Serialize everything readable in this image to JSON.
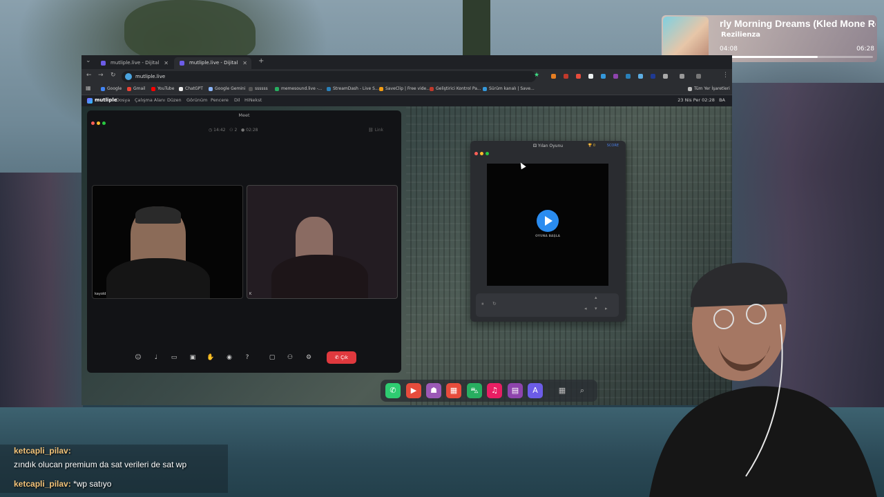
{
  "music": {
    "title": "rly Morning Dreams (Kled Mone Re",
    "artist": "Rezilienza",
    "elapsed": "04:08",
    "duration": "06:28",
    "progress": 0.64
  },
  "browser": {
    "tabs": [
      {
        "label": "mutliple.live - Dijital Çalışma Al",
        "active": false
      },
      {
        "label": "mutliple.live - Dijital Çalışm",
        "active": true
      }
    ],
    "new_tab": "+",
    "url": "mutliple.live",
    "bookmarks": [
      "Google",
      "Gmail",
      "YouTube",
      "ChatGPT",
      "Google Gemini",
      "ssssss",
      "memesound.live -...",
      "StreamDash - Live S...",
      "SaveClip | Free vide...",
      "Geliştirici Kontrol Pa...",
      "Sürüm kanalı | Save..."
    ],
    "all_bookmarks": "Tüm Yer İşaretleri"
  },
  "app": {
    "logo": "mutliple",
    "menus": [
      "Dosya",
      "Çalışma Alanı",
      "Düzen",
      "Görünüm",
      "Pencere",
      "Dil",
      "HiNekst"
    ],
    "datetime": "23 Nis Per   02:28",
    "user_initials": "BA"
  },
  "meet": {
    "title": "Meet",
    "time": "14:42",
    "participants": "2",
    "duration": "02:28",
    "link": "Link",
    "tile1_name": "kayold",
    "tile2_name": "K",
    "leave_label": "Çık"
  },
  "game": {
    "title": "Yılan Oyunu",
    "trophy": "0",
    "score": "SCORE",
    "play_label": "OYUNA BAŞLA"
  },
  "chat": [
    {
      "user": "ketcapli_pilav:",
      "message": ""
    },
    {
      "user": "",
      "message": "zındık olucan premium da sat verileri de sat wp"
    },
    {
      "user": "ketcapli_pilav:",
      "message": "*wp satıyo"
    }
  ]
}
